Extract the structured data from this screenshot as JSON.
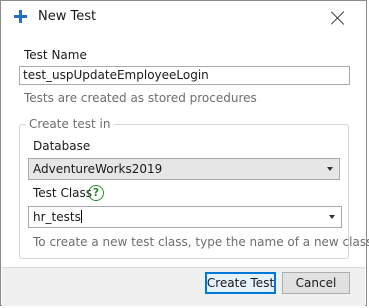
{
  "dialog": {
    "title": "New Test",
    "icon": "plus-icon"
  },
  "test_name": {
    "label": "Test Name",
    "value": "test_uspUpdateEmployeeLogin",
    "hint": "Tests are created as stored procedures"
  },
  "create_test_in": {
    "legend": "Create test in",
    "database": {
      "label": "Database",
      "value": "AdventureWorks2019"
    },
    "test_class": {
      "label": "Test Class",
      "help_icon": "help-icon",
      "help_glyph": "?",
      "value": "hr_tests",
      "hint": "To create a new test class, type the name of a new class"
    }
  },
  "buttons": {
    "create": "Create Test",
    "cancel": "Cancel"
  },
  "colors": {
    "accent": "#1f6fc7",
    "help": "#2e8b2e",
    "primary_border": "#0078d7"
  }
}
